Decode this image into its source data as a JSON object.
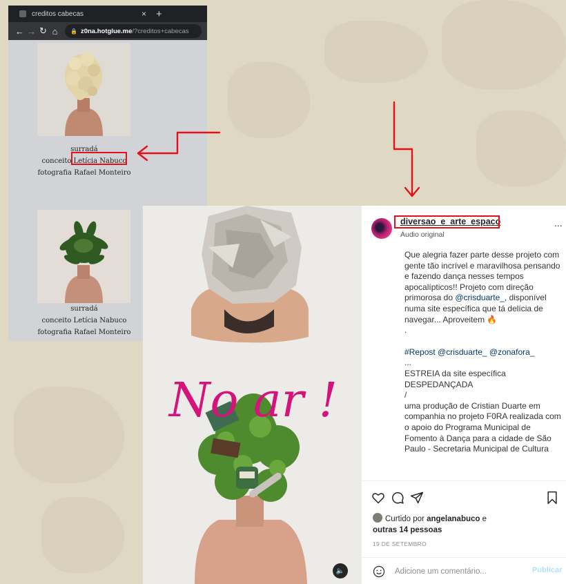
{
  "browser": {
    "tab_title": "creditos cabecas",
    "tab_close": "×",
    "new_tab": "+",
    "url_host": "z0na.hotglue.me",
    "url_path": "/?creditos+cabecas"
  },
  "credits": [
    {
      "title": "surradá",
      "concept_prefix": "conceito ",
      "concept_name": "Letícia Nabuco",
      "photo": "fotografia Rafael Monteiro"
    },
    {
      "title": "surradá",
      "concept_prefix": "conceito ",
      "concept_name": "Letícia Nabuco",
      "photo": "fotografia Rafael Monteiro"
    }
  ],
  "post": {
    "overlay_text": "No ar !",
    "username": "diversao_e_arte_espaco",
    "audio": "Áudio original",
    "more": "...",
    "caption_intro": "Que alegria fazer parte desse projeto com gente tão incrível e maravilhosa pensando e fazendo dança nesses tempos apocalípticos!! Projeto com direção primorosa do ",
    "caption_mention": "@crisduarte_",
    "caption_rest": ", disponível numa site específica que tá delícia de navegar... Aproveitem 🔥\n.",
    "repost": "#Repost @crisduarte_ @zonafora_",
    "caption_body": "...\nESTREIA da site específica\nDESPEDANÇADA\n/\numa produção de Cristian Duarte em companhia no projeto F0RA realizada com o apoio do Programa Municipal de Fomento à Dança para a cidade de São Paulo - Secretaria Municipal de Cultura",
    "liked_prefix": "Curtido por ",
    "liked_user": "angelanabuco",
    "liked_join": " e",
    "liked_others": "outras 14 pessoas",
    "date": "19 DE SETEMBRO",
    "comment_placeholder": "Adicione um comentário...",
    "publish_label": "Publicar"
  },
  "colors": {
    "annotation": "#e3101a",
    "background": "#dfd8c3",
    "overlay_text": "#d4147a"
  }
}
